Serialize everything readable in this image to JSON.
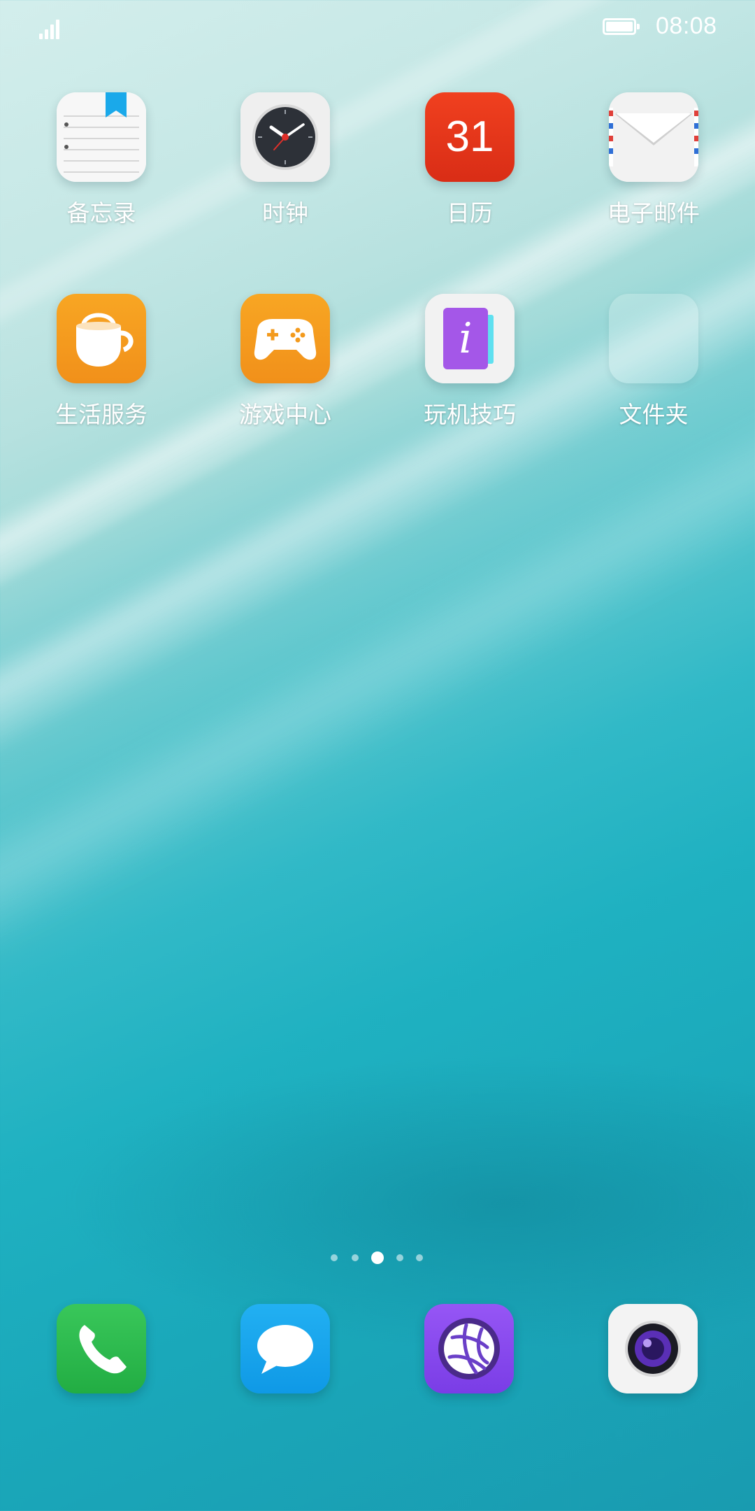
{
  "status_bar": {
    "time": "08:08",
    "battery_level": 1.0,
    "signal_bars": 4
  },
  "apps": [
    {
      "label": "备忘录",
      "icon": "notes-icon"
    },
    {
      "label": "时钟",
      "icon": "clock-icon"
    },
    {
      "label": "日历",
      "icon": "calendar-icon",
      "calendar_day": "31"
    },
    {
      "label": "电子邮件",
      "icon": "mail-icon"
    },
    {
      "label": "生活服务",
      "icon": "coffee-cup-icon"
    },
    {
      "label": "游戏中心",
      "icon": "gamepad-icon"
    },
    {
      "label": "玩机技巧",
      "icon": "tips-icon",
      "glyph": "i"
    },
    {
      "label": "文件夹",
      "icon": "folder-icon"
    }
  ],
  "dock": [
    {
      "icon": "phone-icon"
    },
    {
      "icon": "messages-icon"
    },
    {
      "icon": "browser-icon"
    },
    {
      "icon": "camera-icon"
    }
  ],
  "page_indicator": {
    "total": 5,
    "current": 3
  },
  "colors": {
    "calendar_red": "#e8351d",
    "orange": "#f59a1e",
    "phone_green": "#2dbb4c",
    "messages_blue": "#18a4ec",
    "browser_purple": "#8a4bf0",
    "tips_purple": "#a457e8"
  }
}
